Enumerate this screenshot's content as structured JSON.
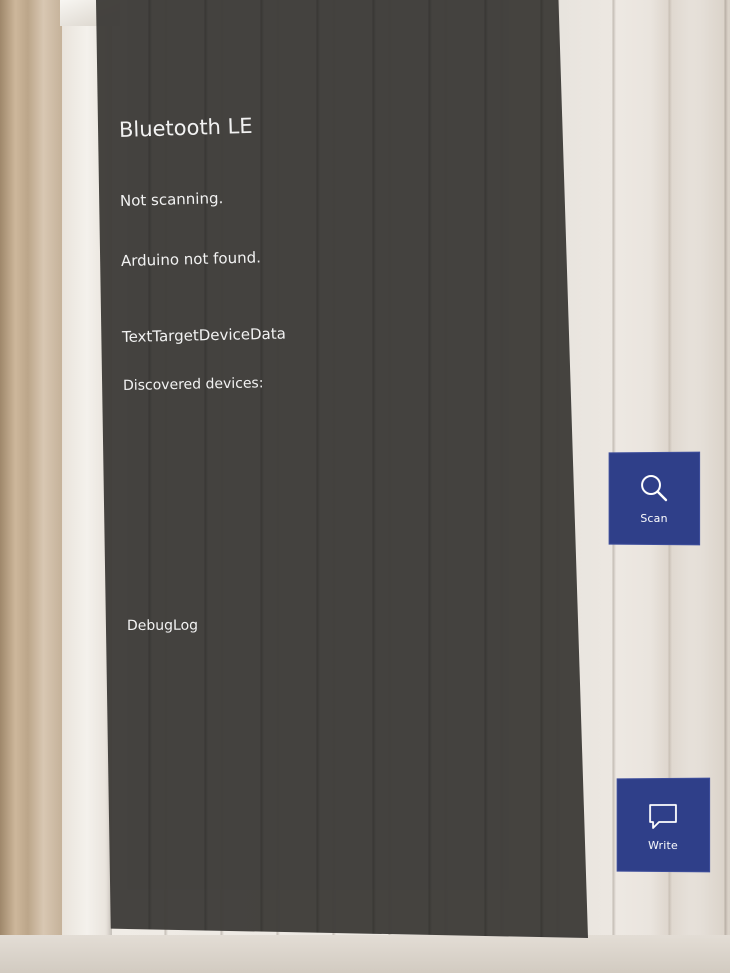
{
  "panel": {
    "title": "Bluetooth LE",
    "scan_status": "Not scanning.",
    "device_status": "Arduino not found.",
    "target_device_data": "TextTargetDeviceData",
    "discovered_label": "Discovered devices:",
    "debug_log": "DebugLog"
  },
  "buttons": {
    "scan": {
      "label": "Scan",
      "icon": "search-icon"
    },
    "write": {
      "label": "Write",
      "icon": "speech-bubble-icon"
    }
  },
  "colors": {
    "panel_background": "#3f3d3a",
    "panel_text": "#f2f2f2",
    "button_background": "#2f3f89"
  }
}
